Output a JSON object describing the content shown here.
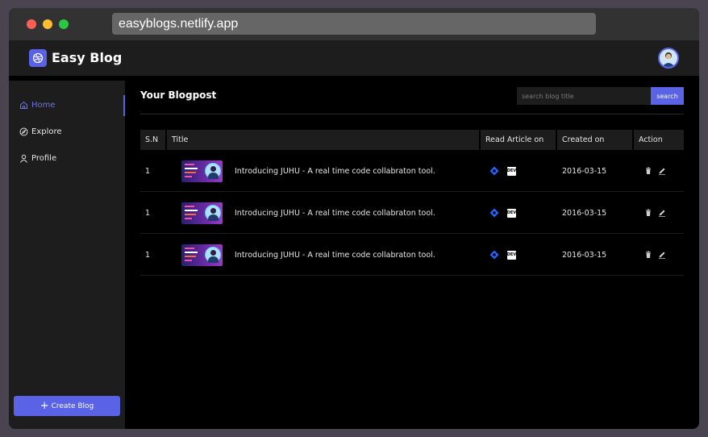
{
  "browser": {
    "url": "easyblogs.netlify.app"
  },
  "app": {
    "title": "Easy Blog"
  },
  "sidebar": {
    "items": [
      {
        "label": "Home",
        "icon": "home-icon",
        "active": true
      },
      {
        "label": "Explore",
        "icon": "compass-icon",
        "active": false
      },
      {
        "label": "Profile",
        "icon": "user-icon",
        "active": false
      }
    ],
    "create_label": "Create Blog"
  },
  "main": {
    "title": "Your Blogpost",
    "search": {
      "placeholder": "search blog title",
      "button_label": "search"
    },
    "table": {
      "headers": [
        "S.N",
        "Title",
        "Read Article on",
        "Created on",
        "Action"
      ],
      "rows": [
        {
          "sn": "1",
          "title": "Introducing JUHU - A real time code collabraton tool.",
          "created": "2016-03-15",
          "dev_label": "DEV"
        },
        {
          "sn": "1",
          "title": "Introducing JUHU - A real time code collabraton tool.",
          "created": "2016-03-15",
          "dev_label": "DEV"
        },
        {
          "sn": "1",
          "title": "Introducing JUHU - A real time code collabraton tool.",
          "created": "2016-03-15",
          "dev_label": "DEV"
        }
      ]
    }
  },
  "colors": {
    "accent": "#5a63e6",
    "background": "#000000",
    "panel": "#1d1d1d"
  }
}
